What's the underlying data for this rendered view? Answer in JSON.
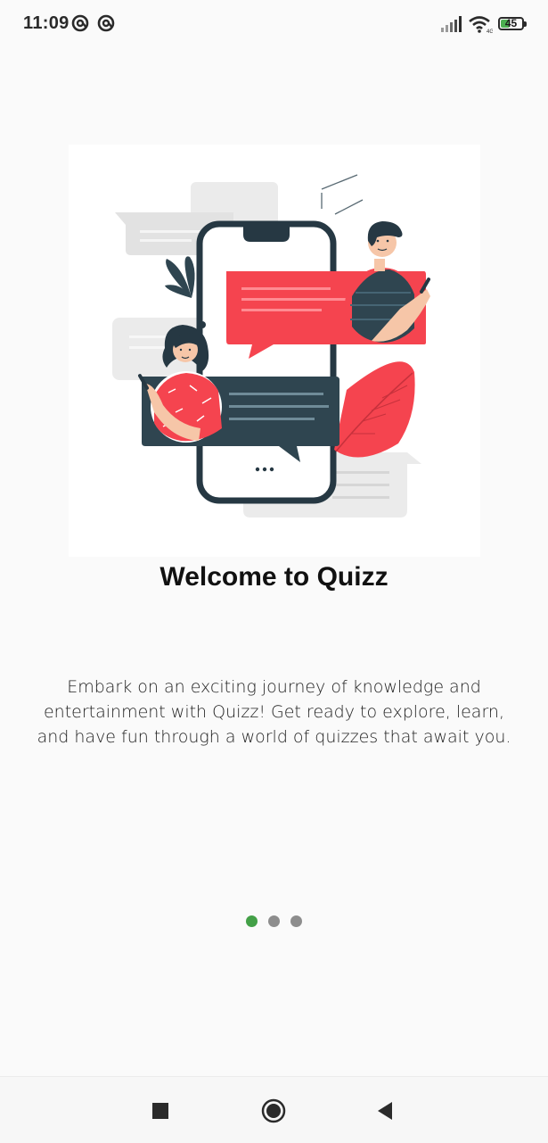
{
  "status_bar": {
    "time": "11:09",
    "battery_level": "45",
    "battery_fraction": 0.45,
    "notification_icons": [
      "at-sign-icon",
      "at-sign-icon"
    ],
    "right_icons": [
      "signal-icon",
      "wifi-icon",
      "battery-icon"
    ]
  },
  "onboarding": {
    "title": "Welcome to Quizz",
    "description": "Embark on an exciting journey of knowledge and entertainment with Quizz! Get ready to explore, learn, and have fun through a world of quizzes that await you.",
    "page_count": 3,
    "current_page": 1
  },
  "nav_bar": {
    "buttons": [
      "recents-square-icon",
      "home-circle-icon",
      "back-triangle-icon"
    ]
  },
  "colors": {
    "accent_green": "#43a047",
    "illustration_red": "#f5444f",
    "illustration_dark": "#2f4550",
    "inactive_dot": "#8d8d8d"
  }
}
